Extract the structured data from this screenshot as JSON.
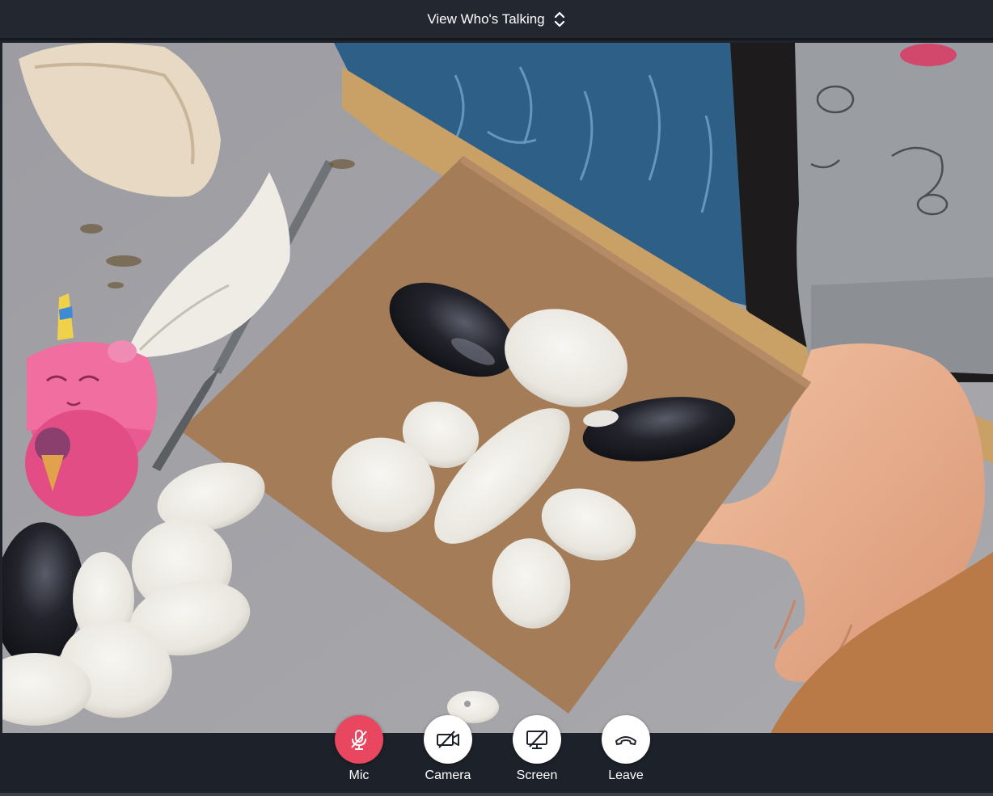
{
  "header": {
    "view_mode_label": "View Who's Talking",
    "view_mode_icon": "chevron-up-down-icon"
  },
  "video": {
    "description_icon": "participant-video-feed"
  },
  "controls": [
    {
      "label": "Mic",
      "icon": "mic-muted-icon",
      "state": "muted",
      "color": "#e8475f"
    },
    {
      "label": "Camera",
      "icon": "camera-off-icon",
      "state": "off",
      "color": "#ffffff"
    },
    {
      "label": "Screen",
      "icon": "screen-share-off-icon",
      "state": "off",
      "color": "#ffffff"
    },
    {
      "label": "Leave",
      "icon": "hang-up-icon",
      "state": "idle",
      "color": "#ffffff"
    }
  ],
  "colors": {
    "accent_red": "#e8475f",
    "bar_background": "#23272f"
  }
}
